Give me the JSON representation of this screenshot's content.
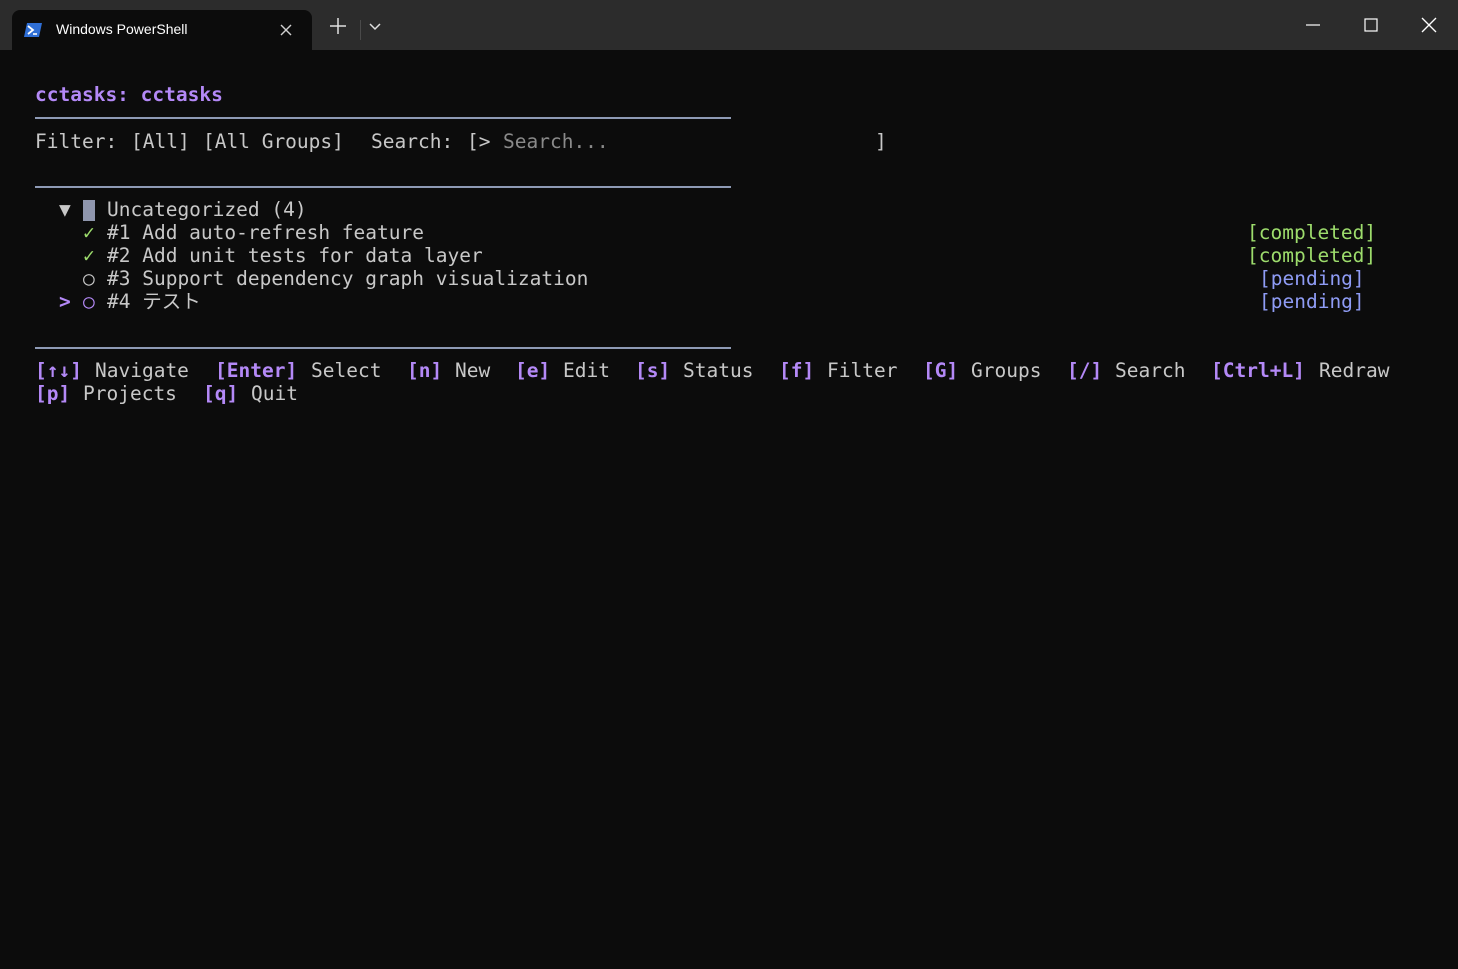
{
  "window": {
    "tab_title": "Windows PowerShell"
  },
  "app": {
    "header": "cctasks: cctasks",
    "filter_label": "Filter:",
    "filter_status": "[All]",
    "filter_group": "[All Groups]",
    "search_label": "Search:",
    "search_prompt": "[>",
    "search_placeholder": "Search...",
    "search_close": "]"
  },
  "group": {
    "expander": "▼",
    "label": "Uncategorized (4)"
  },
  "tasks": [
    {
      "selector": "",
      "icon": "✓",
      "text": "#1 Add auto-refresh feature",
      "status": "[completed]"
    },
    {
      "selector": "",
      "icon": "✓",
      "text": "#2 Add unit tests for data layer",
      "status": "[completed]"
    },
    {
      "selector": "",
      "icon": "○",
      "text": "#3 Support dependency graph visualization",
      "status": "[pending]"
    },
    {
      "selector": ">",
      "icon": "○",
      "text": "#4 テスト",
      "status": "[pending]"
    }
  ],
  "help": {
    "line1": [
      {
        "key": "[↑↓]",
        "label": "Navigate"
      },
      {
        "key": "[Enter]",
        "label": "Select"
      },
      {
        "key": "[n]",
        "label": "New"
      },
      {
        "key": "[e]",
        "label": "Edit"
      },
      {
        "key": "[s]",
        "label": "Status"
      },
      {
        "key": "[f]",
        "label": "Filter"
      },
      {
        "key": "[G]",
        "label": "Groups"
      },
      {
        "key": "[/]",
        "label": "Search"
      },
      {
        "key": "[Ctrl+L]",
        "label": "Redraw"
      }
    ],
    "line2": [
      {
        "key": "[p]",
        "label": "Projects"
      },
      {
        "key": "[q]",
        "label": "Quit"
      }
    ]
  },
  "colors": {
    "accent": "#b489f7",
    "completed": "#9ddc6c",
    "pending": "#8f9cf5",
    "background": "#0c0c0c",
    "titlebar": "#2c2c2c"
  },
  "icons": {
    "tab": "powershell-icon",
    "close_tab": "close-icon",
    "new_tab": "plus-icon",
    "dropdown": "chevron-down-icon",
    "minimize": "minimize-icon",
    "maximize": "maximize-icon",
    "close_window": "close-icon"
  }
}
